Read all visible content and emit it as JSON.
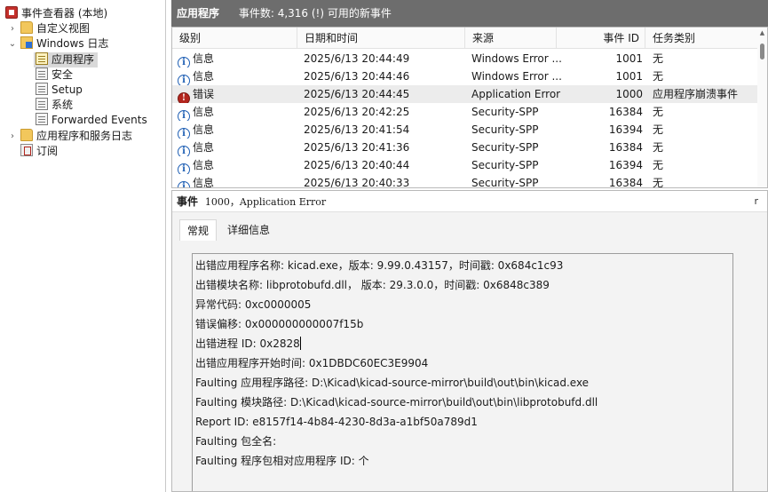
{
  "tree": {
    "root": "事件查看器 (本地)",
    "custom_views": "自定义视图",
    "windows_logs": "Windows 日志",
    "logs": [
      "应用程序",
      "安全",
      "Setup",
      "系统",
      "Forwarded Events"
    ],
    "app_service_logs": "应用程序和服务日志",
    "subscriptions": "订阅"
  },
  "header": {
    "title": "应用程序",
    "count_text": "事件数: 4,316 (!) 可用的新事件"
  },
  "table": {
    "columns": [
      "级别",
      "日期和时间",
      "来源",
      "事件 ID",
      "任务类别"
    ],
    "rows": [
      {
        "level": "信息",
        "type": "info",
        "datetime": "2025/6/13 20:44:49",
        "source": "Windows Error ...",
        "id": "1001",
        "category": "无"
      },
      {
        "level": "信息",
        "type": "info",
        "datetime": "2025/6/13 20:44:46",
        "source": "Windows Error ...",
        "id": "1001",
        "category": "无"
      },
      {
        "level": "错误",
        "type": "error",
        "datetime": "2025/6/13 20:44:45",
        "source": "Application Error",
        "id": "1000",
        "category": "应用程序崩溃事件"
      },
      {
        "level": "信息",
        "type": "info",
        "datetime": "2025/6/13 20:42:25",
        "source": "Security-SPP",
        "id": "16384",
        "category": "无"
      },
      {
        "level": "信息",
        "type": "info",
        "datetime": "2025/6/13 20:41:54",
        "source": "Security-SPP",
        "id": "16394",
        "category": "无"
      },
      {
        "level": "信息",
        "type": "info",
        "datetime": "2025/6/13 20:41:36",
        "source": "Security-SPP",
        "id": "16384",
        "category": "无"
      },
      {
        "level": "信息",
        "type": "info",
        "datetime": "2025/6/13 20:40:44",
        "source": "Security-SPP",
        "id": "16394",
        "category": "无"
      },
      {
        "level": "信息",
        "type": "info",
        "datetime": "2025/6/13 20:40:33",
        "source": "Security-SPP",
        "id": "16384",
        "category": "无"
      }
    ]
  },
  "detail": {
    "title": "事件",
    "title_detail": "1000，Application Error",
    "close_glyph": "r",
    "tabs": [
      "常规",
      "详细信息"
    ],
    "lines": [
      "出错应用程序名称:  kicad.exe，版本:  9.99.0.43157，时间戳:  0x684c1c93",
      "出错模块名称:  libprotobufd.dll， 版本:  29.3.0.0，时间戳:  0x6848c389",
      "异常代码:  0xc0000005",
      "错误偏移:  0x000000000007f15b",
      "出错进程 ID:  0x2828",
      "出错应用程序开始时间:  0x1DBDC60EC3E9904",
      "Faulting 应用程序路径:  D:\\Kicad\\kicad-source-mirror\\build\\out\\bin\\kicad.exe",
      "Faulting 模块路径:  D:\\Kicad\\kicad-source-mirror\\build\\out\\bin\\libprotobufd.dll",
      "Report ID:  e8157f14-4b84-4230-8d3a-a1bf50a789d1",
      "Faulting 包全名:",
      "Faulting 程序包相对应用程序 ID:  个"
    ]
  },
  "colors": {
    "header_bg": "#6d6d6d",
    "selected_tree_bg": "#d9d9d9",
    "info_icon": "#1f5fb4",
    "error_icon": "#b3261e"
  },
  "icons": {
    "root": "event-viewer-icon",
    "folder": "folder-icon",
    "log": "log-icon",
    "info": "info-circle-icon",
    "error": "error-circle-icon"
  }
}
